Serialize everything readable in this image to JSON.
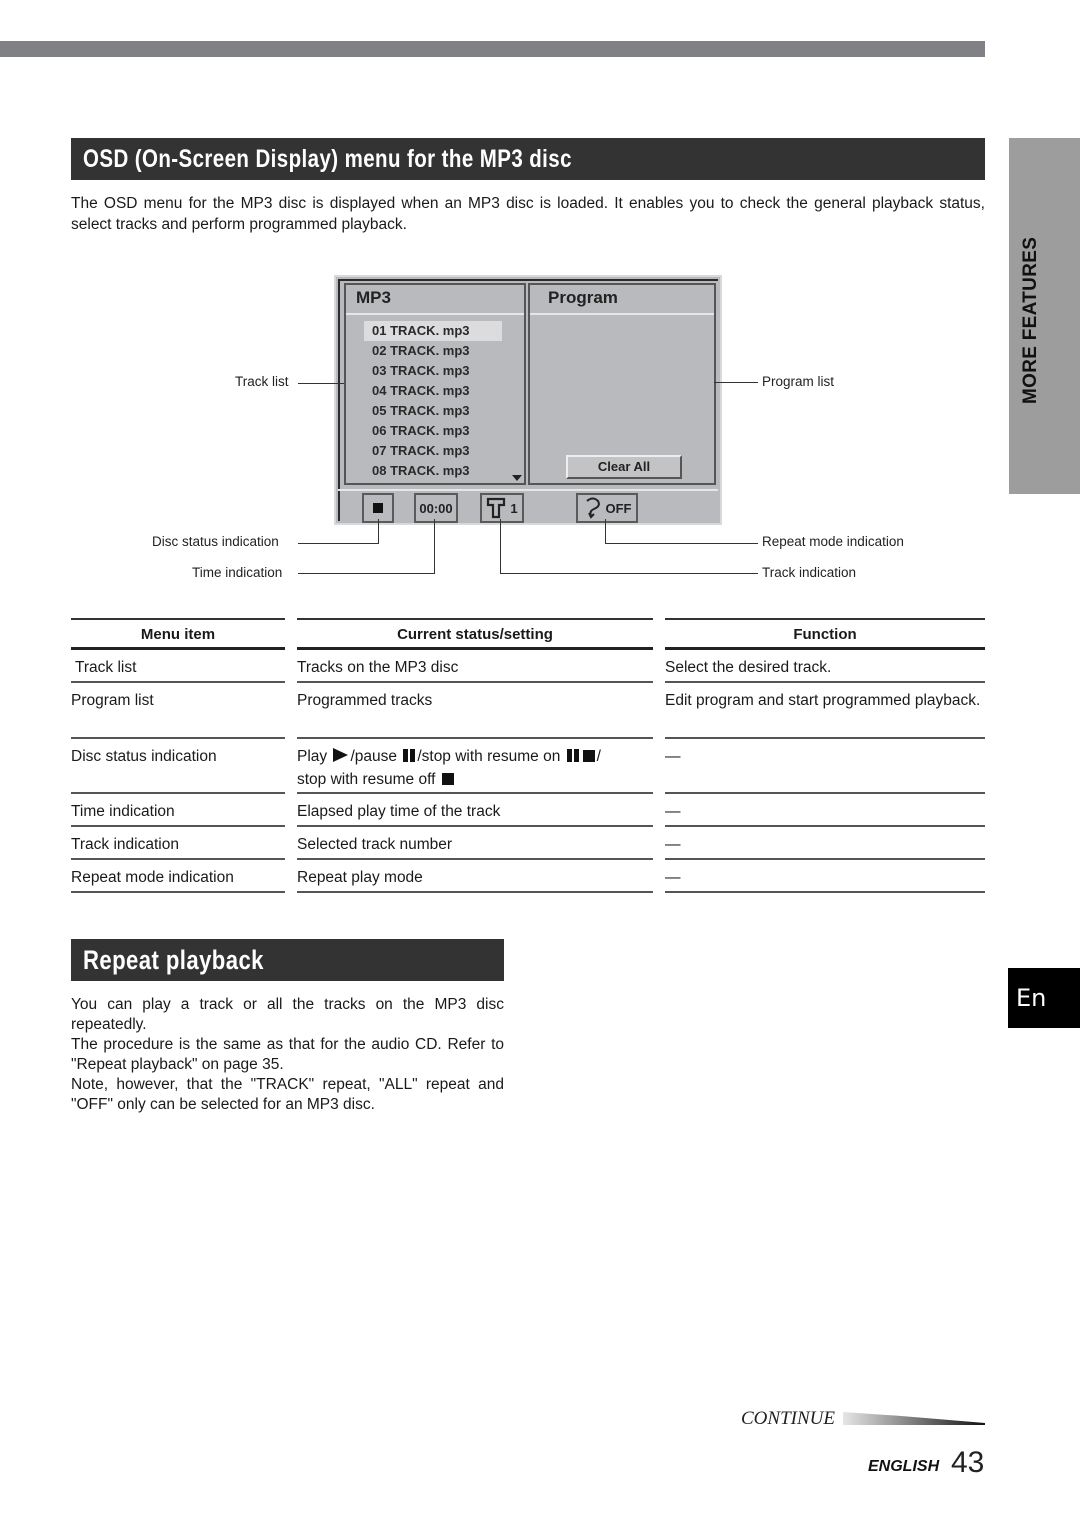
{
  "page": {
    "section_tab": "MORE FEATURES",
    "language_tab": "En",
    "continue_label": "CONTINUE",
    "footer_language": "ENGLISH",
    "page_number": "43"
  },
  "osd_section": {
    "title": "OSD (On-Screen Display) menu for the MP3 disc",
    "intro": "The OSD menu for the MP3 disc is displayed when an MP3 disc is loaded. It enables you to check the general playback status, select tracks and perform programmed playback."
  },
  "osd_screen": {
    "mp3_header": "MP3",
    "program_header": "Program",
    "tracks": [
      "01 TRACK. mp3",
      "02 TRACK. mp3",
      "03 TRACK. mp3",
      "04 TRACK. mp3",
      "05 TRACK. mp3",
      "06 TRACK. mp3",
      "07 TRACK. mp3",
      "08 TRACK. mp3"
    ],
    "selected_track_index": 0,
    "clear_all_label": "Clear All",
    "time_value": "00:00",
    "track_number": "1",
    "repeat_value": "OFF",
    "icons": {
      "disc_status": "stop-icon",
      "track": "track-t-icon",
      "repeat": "repeat-icon",
      "scroll": "scroll-down-arrow-icon"
    }
  },
  "callouts": {
    "track_list": "Track list",
    "program_list": "Program list",
    "disc_status": "Disc status indication",
    "time": "Time indication",
    "repeat_mode": "Repeat mode indication",
    "track": "Track indication"
  },
  "table": {
    "headers": [
      "Menu item",
      "Current status/setting",
      "Function"
    ],
    "rows": [
      {
        "item": "Track list",
        "status": "Tracks on the MP3 disc",
        "function": "Select the desired track."
      },
      {
        "item": "Program list",
        "status": "Programmed tracks",
        "function": "Edit program and start programmed playback."
      },
      {
        "item": "Disc status indication",
        "status_parts": {
          "play": "Play",
          "pause": "/pause",
          "stop_resume_on": "/stop with resume on",
          "slash": "/",
          "stop_resume_off": "stop with resume off"
        },
        "function": "—"
      },
      {
        "item": "Time indication",
        "status": "Elapsed play time of the track",
        "function": "—"
      },
      {
        "item": "Track indication",
        "status": "Selected track number",
        "function": "—"
      },
      {
        "item": "Repeat mode indication",
        "status": "Repeat play mode",
        "function": "—"
      }
    ]
  },
  "repeat_section": {
    "title": "Repeat playback",
    "paragraphs": [
      "You can play a track or all the tracks on the MP3 disc repeatedly.",
      "The procedure is the same as that for the audio CD. Refer to \"Repeat playback\" on page 35.",
      "Note, however, that the \"TRACK\" repeat, \"ALL\" repeat and \"OFF\" only can be selected for an MP3 disc."
    ]
  }
}
